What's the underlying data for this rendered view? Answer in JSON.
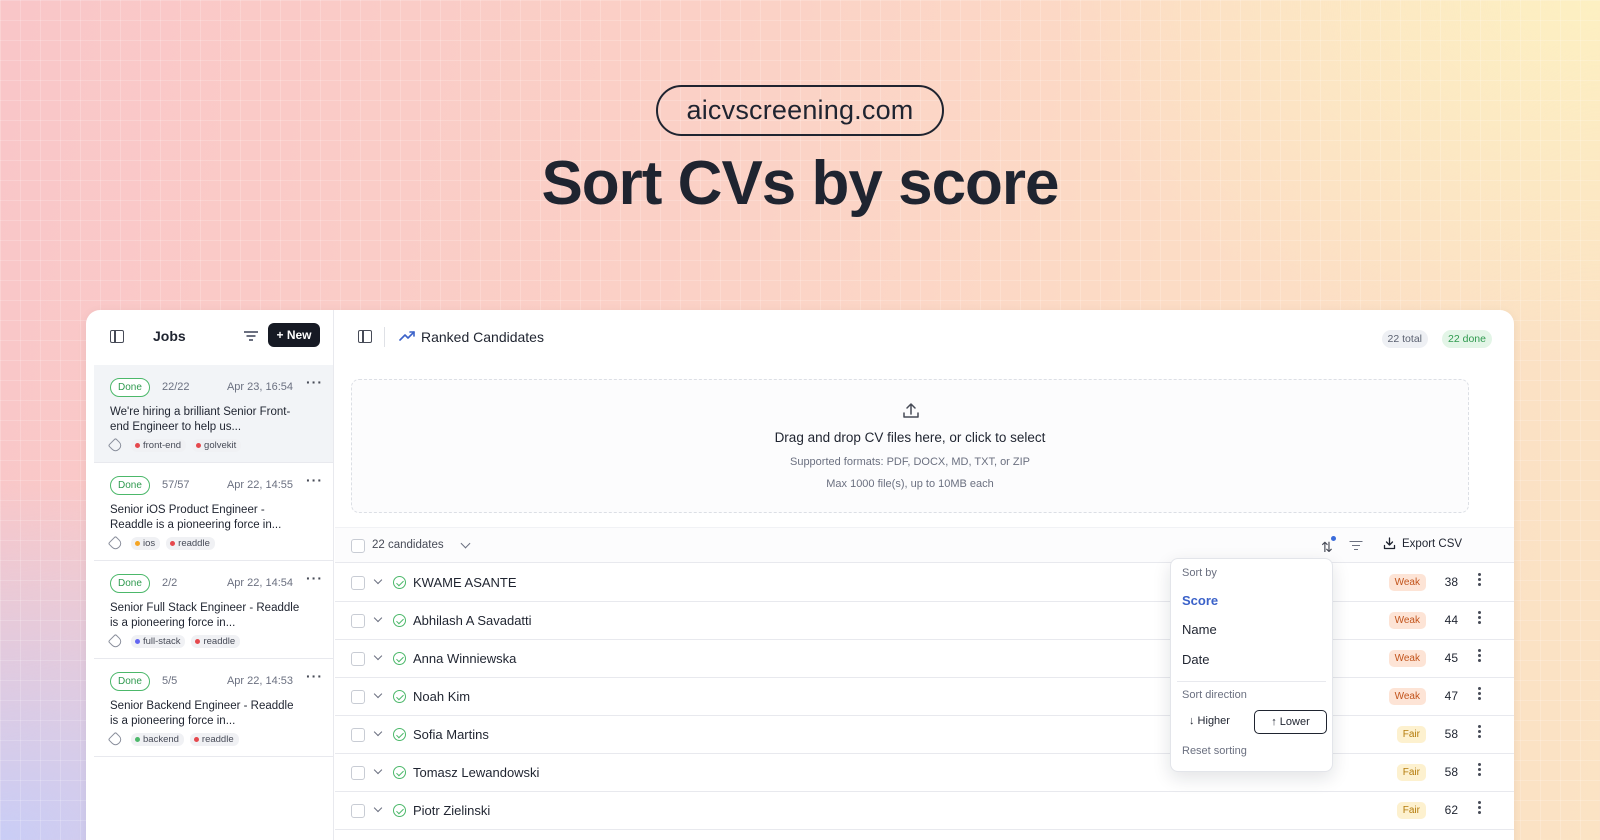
{
  "hero": {
    "domain": "aicvscreening.com",
    "title": "Sort CVs by score"
  },
  "sidebar": {
    "title": "Jobs",
    "new_label": "New",
    "jobs": [
      {
        "status": "Done",
        "count": "22/22",
        "date": "Apr 23, 16:54",
        "desc": "We're hiring a brilliant Senior Front-end Engineer to help us...",
        "tags": [
          {
            "label": "front-end",
            "color": "#e5484d"
          },
          {
            "label": "golvekit",
            "color": "#e5484d"
          }
        ],
        "active": true
      },
      {
        "status": "Done",
        "count": "57/57",
        "date": "Apr 22, 14:55",
        "desc": "Senior iOS Product Engineer - Readdle is a pioneering force in...",
        "tags": [
          {
            "label": "ios",
            "color": "#f5a524"
          },
          {
            "label": "readdle",
            "color": "#e5484d"
          }
        ],
        "active": false
      },
      {
        "status": "Done",
        "count": "2/2",
        "date": "Apr 22, 14:54",
        "desc": "Senior Full Stack Engineer - Readdle is a pioneering force in...",
        "tags": [
          {
            "label": "full-stack",
            "color": "#6366f1"
          },
          {
            "label": "readdle",
            "color": "#e5484d"
          }
        ],
        "active": false
      },
      {
        "status": "Done",
        "count": "5/5",
        "date": "Apr 22, 14:53",
        "desc": "Senior Backend Engineer - Readdle is a pioneering force in...",
        "tags": [
          {
            "label": "backend",
            "color": "#4cb86a"
          },
          {
            "label": "readdle",
            "color": "#e5484d"
          }
        ],
        "active": false
      }
    ]
  },
  "main": {
    "title": "Ranked Candidates",
    "total": "22 total",
    "done": "22 done",
    "dropzone": {
      "title": "Drag and drop CV files here, or click to select",
      "formats": "Supported formats: PDF, DOCX, MD, TXT, or ZIP",
      "limit": "Max 1000 file(s), up to 10MB each"
    },
    "list": {
      "count_label": "22 candidates",
      "export_label": "Export CSV"
    },
    "candidates": [
      {
        "name": "KWAME ASANTE",
        "rating": "Weak",
        "score": "38"
      },
      {
        "name": "Abhilash A Savadatti",
        "rating": "Weak",
        "score": "44"
      },
      {
        "name": "Anna Winniewska",
        "rating": "Weak",
        "score": "45"
      },
      {
        "name": "Noah Kim",
        "rating": "Weak",
        "score": "47"
      },
      {
        "name": "Sofia Martins",
        "rating": "Fair",
        "score": "58"
      },
      {
        "name": "Tomasz Lewandowski",
        "rating": "Fair",
        "score": "58"
      },
      {
        "name": "Piotr Zielinski",
        "rating": "Fair",
        "score": "62"
      }
    ]
  },
  "sort_popover": {
    "sort_by_label": "Sort by",
    "options": [
      "Score",
      "Name",
      "Date"
    ],
    "selected": "Score",
    "direction_label": "Sort direction",
    "higher_label": "↓ Higher",
    "lower_label": "↑ Lower",
    "selected_direction": "Lower",
    "reset_label": "Reset sorting"
  }
}
